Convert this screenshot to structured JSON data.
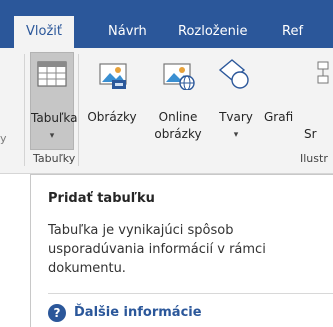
{
  "tabs": [
    {
      "label": "Vložiť",
      "active": true
    },
    {
      "label": "Návrh",
      "active": false
    },
    {
      "label": "Rozloženie",
      "active": false
    },
    {
      "label": "Ref",
      "active": false
    }
  ],
  "ribbon": {
    "left_edge_label": "y",
    "buttons": {
      "table": {
        "label": "Tabuľka",
        "icon": "table-icon",
        "caret": "▾"
      },
      "pictures": {
        "label": "Obrázky",
        "icon": "pictures-icon"
      },
      "online_pictures": {
        "label_line1": "Online",
        "label_line2": "obrázky",
        "icon": "online-pictures-icon"
      },
      "shapes": {
        "label": "Tvary",
        "icon": "shapes-icon",
        "caret": "▾"
      },
      "smartart": {
        "label_line1": "Grafi",
        "label_line2": "Sr",
        "icon": "smartart-icon"
      }
    },
    "groups": {
      "tables": "Tabuľky",
      "illustrations": "Ilustr"
    }
  },
  "tooltip": {
    "title": "Pridať tabuľku",
    "description": "Tabuľka je vynikajúci spôsob usporadúvania informácií v rámci dokumentu.",
    "more_icon": "help-icon",
    "more_label": "Ďalšie informácie"
  },
  "colors": {
    "accent": "#2b579a",
    "ribbon_bg": "#f3f3f3",
    "pressed_bg": "#c6c6c6"
  }
}
